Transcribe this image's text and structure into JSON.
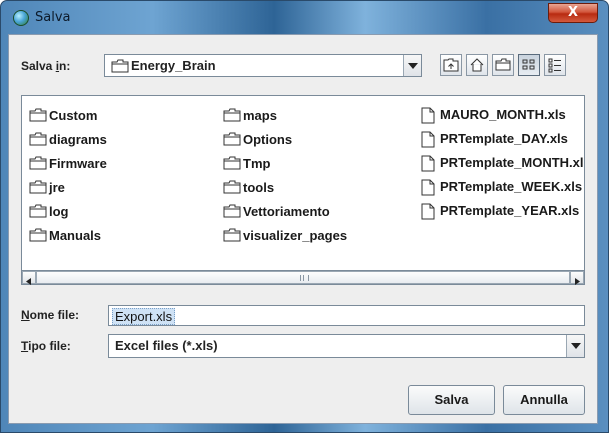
{
  "window": {
    "title": "Salva",
    "close_label": "X"
  },
  "lookin": {
    "label_prefix": "Salva ",
    "label_mnemonic": "i",
    "label_suffix": "n:",
    "value": "Energy_Brain"
  },
  "toolbar": {
    "up_icon": "up-folder-icon",
    "home_icon": "home-icon",
    "new_folder_icon": "new-folder-icon",
    "list_icon": "list-view-icon",
    "details_icon": "details-view-icon"
  },
  "files": {
    "col1": [
      "Custom",
      "diagrams",
      "Firmware",
      "jre",
      "log",
      "Manuals"
    ],
    "col2": [
      "maps",
      "Options",
      "Tmp",
      "tools",
      "Vettoriamento",
      "visualizer_pages"
    ],
    "col3": [
      "MAURO_MONTH.xls",
      "PRTemplate_DAY.xls",
      "PRTemplate_MONTH.xls",
      "PRTemplate_WEEK.xls",
      "PRTemplate_YEAR.xls"
    ]
  },
  "filename": {
    "label_mnemonic": "N",
    "label_suffix": "ome file:",
    "value": "Export.xls"
  },
  "filetype": {
    "label_mnemonic": "T",
    "label_suffix": "ipo file:",
    "value": "Excel files (*.xls)"
  },
  "buttons": {
    "save": "Salva",
    "cancel": "Annulla"
  }
}
